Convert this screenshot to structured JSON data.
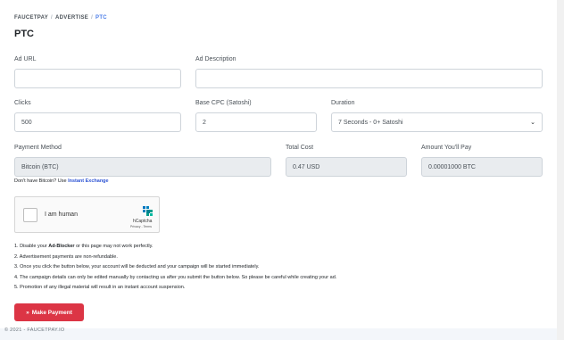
{
  "breadcrumb": {
    "item1": "FAUCETPAY",
    "item2": "ADVERTISE",
    "item3": "PTC",
    "separator": "/"
  },
  "page_title": "PTC",
  "form": {
    "ad_url": {
      "label": "Ad URL",
      "value": ""
    },
    "ad_description": {
      "label": "Ad Description",
      "value": ""
    },
    "clicks": {
      "label": "Clicks",
      "value": "500"
    },
    "base_cpc": {
      "label": "Base CPC (Satoshi)",
      "value": "2"
    },
    "duration": {
      "label": "Duration",
      "value": "7 Seconds - 0+ Satoshi"
    },
    "payment_method": {
      "label": "Payment Method",
      "value": "Bitcoin (BTC)"
    },
    "total_cost": {
      "label": "Total Cost",
      "value": "0.47 USD"
    },
    "amount_pay": {
      "label": "Amount You'll Pay",
      "value": "0.00001000 BTC"
    }
  },
  "hint": {
    "text": "Don't have Bitcoin? Use ",
    "link": "Instant Exchange"
  },
  "captcha": {
    "label": "I am human",
    "brand": "hCaptcha",
    "terms": "Privacy - Terms"
  },
  "notes": {
    "n1_pre": "1. Disable your ",
    "n1_bold": "Ad-Blocker",
    "n1_post": " or this page may not work perfectly.",
    "n2": "2. Advertisement payments are non-refundable.",
    "n3": "3. Once you click the button below, your account will be deducted and your campaign will be started immediately.",
    "n4": "4. The campaign details can only be edited manually by contacting us after you submit the button below. So please be careful while creating your ad.",
    "n5": "5. Promotion of any illegal material will result in an instant account suspension."
  },
  "pay_button": {
    "icon": "»",
    "label": "Make Payment"
  },
  "footer": "© 2021 - FAUCETPAY.IO",
  "colors": {
    "accent": "#4a7ce8",
    "danger": "#dc3545",
    "link": "#2f55d4"
  }
}
